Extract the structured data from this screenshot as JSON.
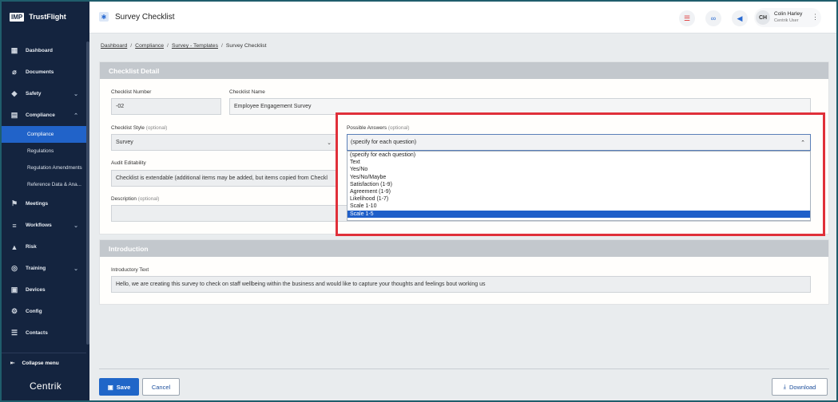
{
  "brand": {
    "logo": "IMP",
    "name": "TrustFlight",
    "footer": "Centrik"
  },
  "nav": {
    "items": [
      {
        "label": "Dashboard",
        "icon": "dashboard-icon",
        "glyph": "▦"
      },
      {
        "label": "Documents",
        "icon": "paperclip-icon",
        "glyph": "⌀"
      },
      {
        "label": "Safety",
        "icon": "shield-icon",
        "glyph": "◆",
        "chevron": "⌄"
      },
      {
        "label": "Compliance",
        "icon": "document-icon",
        "glyph": "▤",
        "chevron": "⌃"
      }
    ],
    "sub_items": [
      {
        "label": "Compliance",
        "active": true
      },
      {
        "label": "Regulations"
      },
      {
        "label": "Regulation Amendments"
      },
      {
        "label": "Reference Data & Ana..."
      }
    ],
    "items2": [
      {
        "label": "Meetings",
        "icon": "meetings-icon",
        "glyph": "⚑"
      },
      {
        "label": "Workflows",
        "icon": "workflows-icon",
        "glyph": "≡",
        "chevron": "⌄"
      },
      {
        "label": "Risk",
        "icon": "risk-icon",
        "glyph": "▲"
      },
      {
        "label": "Training",
        "icon": "training-icon",
        "glyph": "◎",
        "chevron": "⌄"
      },
      {
        "label": "Devices",
        "icon": "devices-icon",
        "glyph": "▣"
      },
      {
        "label": "Config",
        "icon": "config-icon",
        "glyph": "⚙"
      },
      {
        "label": "Contacts",
        "icon": "contacts-icon",
        "glyph": "☰"
      }
    ],
    "collapse_label": "Collapse menu"
  },
  "header": {
    "title": "Survey Checklist",
    "user": {
      "initials": "CH",
      "name": "Colin Harley",
      "role": "Centrik User"
    }
  },
  "breadcrumb": [
    "Dashboard",
    "Compliance",
    "Survey - Templates",
    "Survey Checklist"
  ],
  "checklist_detail": {
    "heading": "Checklist Detail",
    "number_label": "Checklist Number",
    "number_value": "-02",
    "name_label": "Checklist Name",
    "name_value": "Employee Engagement Survey",
    "style_label": "Checklist Style",
    "style_optional": "(optional)",
    "style_value": "Survey",
    "answers_label": "Possible Answers",
    "answers_optional": "(optional)",
    "answers_value": "(specify for each question)",
    "answers_options": [
      "(specify for each question)",
      "Text",
      "Yes/No",
      "Yes/No/Maybe",
      "Satisfaction (1-9)",
      "Agreement (1-9)",
      "Likelihood (1-7)",
      "Scale 1-10",
      "Scale 1-5"
    ],
    "answers_selected_index": 8,
    "audit_label": "Audit Editability",
    "audit_value": "Checklist is extendable (additional items may be added, but items copied from Checkl",
    "desc_label": "Description",
    "desc_optional": "(optional)"
  },
  "introduction": {
    "heading": "Introduction",
    "text_label": "Introductory Text",
    "text_value": "Hello, we are creating this survey to check on staff wellbeing within the business and would like to capture your thoughts and feelings bout working us"
  },
  "actions": {
    "save": "Save",
    "cancel": "Cancel",
    "download": "Download"
  },
  "colors": {
    "sidebar": "#14243f",
    "accent": "#2066c8",
    "highlight": "#e0303a"
  }
}
